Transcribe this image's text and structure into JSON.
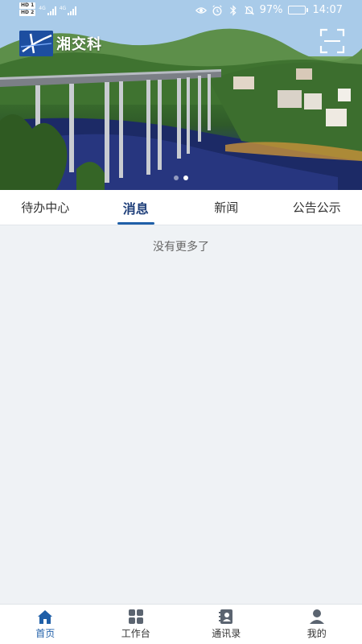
{
  "status_bar": {
    "sim1": "HD 1",
    "sim2": "HD 2",
    "net1": "4G",
    "net2": "4G",
    "battery_percent": "97%",
    "battery_level": 0.97,
    "time": "14:07"
  },
  "banner": {
    "logo_text": "湘交科",
    "slide_count": 2,
    "active_slide": 1
  },
  "tabs": [
    {
      "label": "待办中心",
      "active": false
    },
    {
      "label": "消息",
      "active": true
    },
    {
      "label": "新闻",
      "active": false
    },
    {
      "label": "公告公示",
      "active": false
    }
  ],
  "content": {
    "empty_message": "没有更多了"
  },
  "bottom_nav": [
    {
      "label": "首页",
      "icon": "home-icon",
      "active": true
    },
    {
      "label": "工作台",
      "icon": "grid-icon",
      "active": false
    },
    {
      "label": "通讯录",
      "icon": "contacts-icon",
      "active": false
    },
    {
      "label": "我的",
      "icon": "user-icon",
      "active": false
    }
  ],
  "colors": {
    "accent": "#1f5fa8",
    "active_tab_text": "#1f3f7a",
    "background": "#eff2f5"
  }
}
